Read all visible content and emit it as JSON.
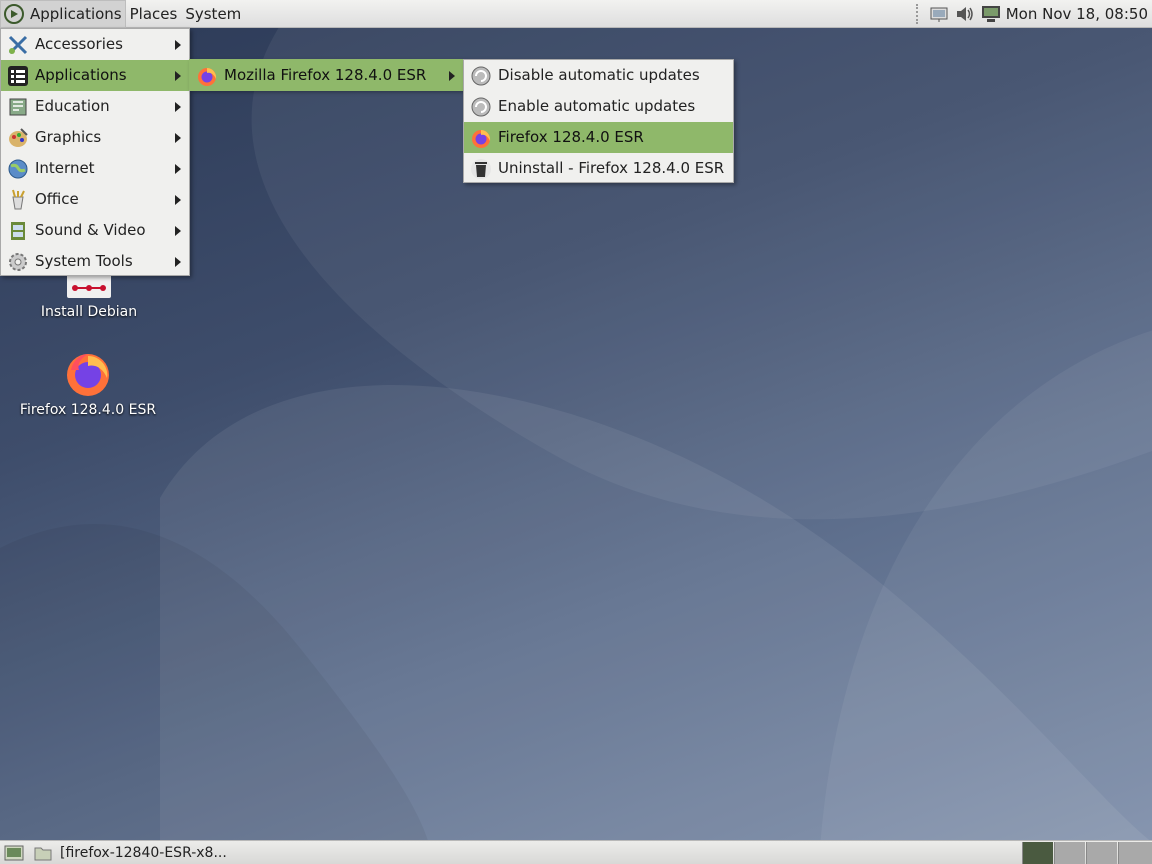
{
  "top_panel": {
    "menus": [
      {
        "label": "Applications"
      },
      {
        "label": "Places"
      },
      {
        "label": "System"
      }
    ],
    "clock": "Mon Nov 18, 08:50",
    "tray_icons": [
      "network-icon",
      "volume-icon",
      "display-icon"
    ]
  },
  "applications_menu": {
    "items": [
      {
        "label": "Accessories",
        "icon": "accessories-icon"
      },
      {
        "label": "Applications",
        "icon": "list-icon"
      },
      {
        "label": "Education",
        "icon": "education-icon"
      },
      {
        "label": "Graphics",
        "icon": "graphics-icon"
      },
      {
        "label": "Internet",
        "icon": "globe-icon"
      },
      {
        "label": "Office",
        "icon": "office-icon"
      },
      {
        "label": "Sound & Video",
        "icon": "film-icon"
      },
      {
        "label": "System Tools",
        "icon": "gear-icon"
      }
    ]
  },
  "applications_submenu": {
    "items": [
      {
        "label": "Mozilla Firefox 128.4.0 ESR",
        "icon": "firefox-icon"
      }
    ]
  },
  "firefox_submenu": {
    "items": [
      {
        "label": "Disable automatic updates",
        "icon": "update-icon"
      },
      {
        "label": "Enable automatic updates",
        "icon": "update-icon"
      },
      {
        "label": "Firefox 128.4.0 ESR",
        "icon": "firefox-icon"
      },
      {
        "label": "Uninstall - Firefox 128.4.0 ESR",
        "icon": "trash-icon"
      }
    ]
  },
  "desktop": {
    "icons": [
      {
        "label": "Install Debian"
      },
      {
        "label": "Firefox 128.4.0 ESR"
      }
    ]
  },
  "bottom_panel": {
    "task": "[firefox-12840-ESR-x8..."
  },
  "colors": {
    "highlight": "#8fb86a",
    "menu_bg": "#f0f0ee",
    "desktop": "#3e4d6b"
  }
}
